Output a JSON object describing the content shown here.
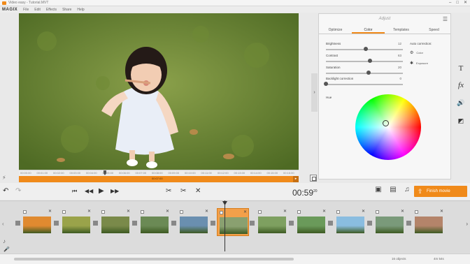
{
  "window": {
    "title": "Video easy - Tutorial.MVT",
    "controls": [
      "–",
      "□",
      "✕"
    ]
  },
  "menubar": {
    "brand": "MAGIX",
    "items": [
      "File",
      "Edit",
      "Effects",
      "Share",
      "Help"
    ]
  },
  "ruler": {
    "ticks": [
      "00:00:00",
      "00:01:00",
      "00:02:00",
      "00:03:00",
      "00:04:00",
      "00:05:00",
      "00:06:00",
      "00:07:00",
      "00:08:00",
      "00:09:00",
      "00:10:00",
      "00:11:00",
      "00:12:00",
      "00:13:00",
      "00:14:00",
      "00:15:00",
      "00:16:00"
    ]
  },
  "progress": {
    "time": "00:07:00",
    "end_label": "▸"
  },
  "adjust": {
    "title": "Adjust",
    "tabs": [
      "Optimize",
      "Color",
      "Templates",
      "Speed"
    ],
    "active_tab": "Color",
    "sliders": [
      {
        "label": "Brightness",
        "value": "12",
        "fraction": 0.52
      },
      {
        "label": "Contrast",
        "value": "63",
        "fraction": 0.57
      },
      {
        "label": "Saturation",
        "value": "20",
        "fraction": 0.55
      },
      {
        "label": "Backlight correction",
        "value": "0",
        "fraction": 0.0
      }
    ],
    "auto_correction": {
      "header": "Auto correction:",
      "options": [
        {
          "icon": "color-auto-icon",
          "label": "Color"
        },
        {
          "icon": "exposure-auto-icon",
          "label": "Exposure"
        }
      ]
    },
    "hue_label": "Hue"
  },
  "tools": [
    {
      "name": "title-tool-icon",
      "glyph": "T"
    },
    {
      "name": "effects-tool-icon",
      "glyph": "fx"
    },
    {
      "name": "audio-tool-icon",
      "glyph": "🔊"
    },
    {
      "name": "crop-tool-icon",
      "glyph": "◩"
    }
  ],
  "transport": {
    "timecode": "00:59",
    "frames": "20"
  },
  "finish": {
    "label": "Finish movie"
  },
  "timeline": {
    "clip_colors": [
      "#e08a30",
      "#9aa34a",
      "#7a8a4a",
      "#6b8a55",
      "#6a8fb0",
      "#8aa070",
      "#7ea060",
      "#6a9a5a",
      "#8abde0",
      "#7a9a7a",
      "#b4846a"
    ]
  },
  "status": {
    "objects": "16 objects",
    "length": "4m 54s"
  }
}
